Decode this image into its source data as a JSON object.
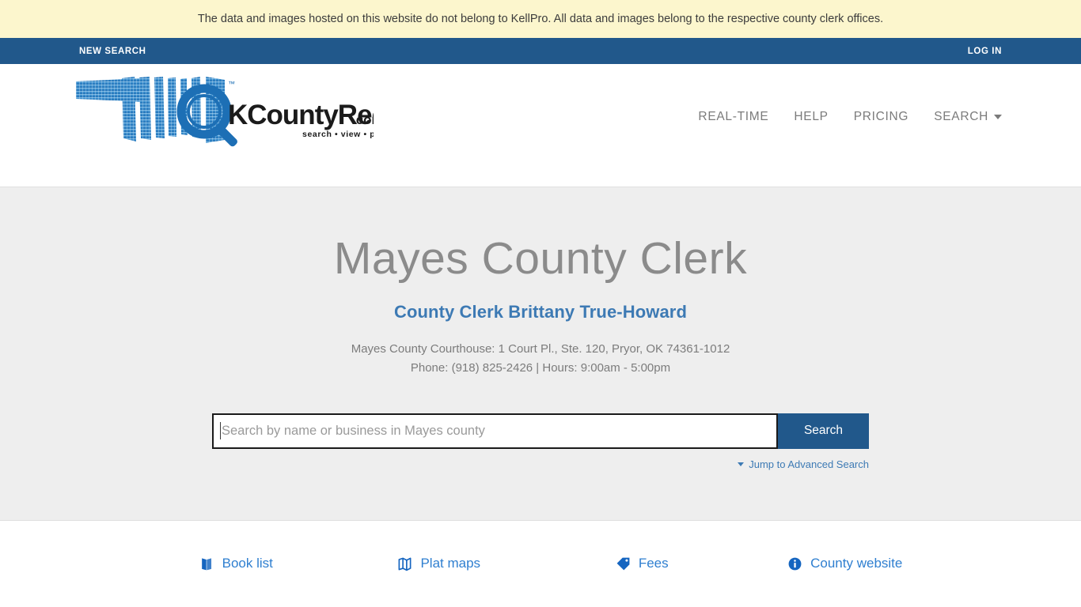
{
  "disclaimer": {
    "text": "The data and images hosted on this website do not belong to KellPro. All data and images belong to the respective county clerk offices."
  },
  "utility_nav": {
    "new_search": "NEW SEARCH",
    "log_in": "LOG IN"
  },
  "brand": {
    "name": "OKCountyRecords",
    "tld": ".com",
    "tagline": "search • view • print",
    "trademark": "™"
  },
  "main_nav": {
    "items": [
      {
        "label": "REAL-TIME"
      },
      {
        "label": "HELP"
      },
      {
        "label": "PRICING"
      },
      {
        "label": "SEARCH"
      }
    ]
  },
  "hero": {
    "title": "Mayes County Clerk",
    "clerk": "County Clerk Brittany True-Howard",
    "address": "Mayes County Courthouse: 1 Court Pl., Ste. 120, Pryor, OK 74361-1012",
    "contact": "Phone: (918) 825-2426 | Hours: 9:00am - 5:00pm"
  },
  "search": {
    "value": "",
    "placeholder": "Search by name or business in Mayes county",
    "button_label": "Search",
    "advanced_label": "Jump to Advanced Search"
  },
  "quick_links": {
    "items": [
      {
        "label": "Book list",
        "icon": "book-icon"
      },
      {
        "label": "Plat maps",
        "icon": "map-icon"
      },
      {
        "label": "Fees",
        "icon": "tag-icon"
      },
      {
        "label": "County website",
        "icon": "info-circle-icon"
      }
    ]
  },
  "colors": {
    "banner_yellow": "#fcf6cd",
    "nav_blue": "#21588b",
    "link_blue": "#3d7ab4",
    "quicklink_blue": "#2f7fd0",
    "hero_gray": "#eeeeee"
  }
}
